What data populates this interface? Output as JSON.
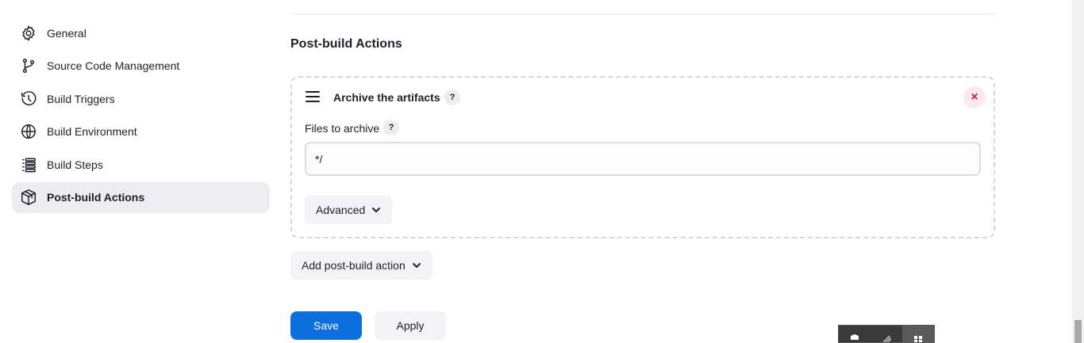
{
  "sidebar": {
    "items": [
      {
        "label": "General",
        "icon": "gear-icon"
      },
      {
        "label": "Source Code Management",
        "icon": "git-branch-icon"
      },
      {
        "label": "Build Triggers",
        "icon": "clock-icon"
      },
      {
        "label": "Build Environment",
        "icon": "globe-icon"
      },
      {
        "label": "Build Steps",
        "icon": "list-icon"
      },
      {
        "label": "Post-build Actions",
        "icon": "package-icon"
      }
    ],
    "active_index": 5
  },
  "main": {
    "section_title": "Post-build Actions",
    "card": {
      "title": "Archive the artifacts",
      "help": "?",
      "close": "×",
      "field_label": "Files to archive",
      "field_help": "?",
      "field_value": "*/",
      "advanced_label": "Advanced"
    },
    "add_action_label": "Add post-build action",
    "save_label": "Save",
    "apply_label": "Apply"
  },
  "colors": {
    "primary": "#0b6fde",
    "danger": "#e8124a",
    "active_bg": "#ececf1"
  }
}
